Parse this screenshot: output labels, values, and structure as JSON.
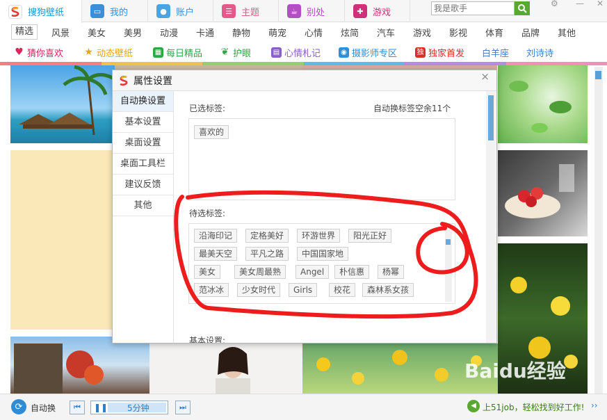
{
  "tabs": [
    {
      "label": "搜狗壁纸",
      "icon": "sogou-logo-icon",
      "color": "#1a9ad6"
    },
    {
      "label": "我的",
      "icon": "monitor-icon",
      "color": "#3a8fd8"
    },
    {
      "label": "账户",
      "icon": "user-icon",
      "color": "#4ba3e0"
    },
    {
      "label": "主题",
      "icon": "theme-icon",
      "color": "#e45a8a"
    },
    {
      "label": "别处",
      "icon": "elsewhere-icon",
      "color": "#b44ec4"
    },
    {
      "label": "游戏",
      "icon": "gamepad-icon",
      "color": "#d0307a"
    }
  ],
  "search": {
    "placeholder": "我是歌手"
  },
  "categories": [
    "精选",
    "风景",
    "美女",
    "美男",
    "动漫",
    "卡通",
    "静物",
    "萌宠",
    "心情",
    "炫简",
    "汽车",
    "游戏",
    "影视",
    "体育",
    "品牌",
    "其他"
  ],
  "features": [
    {
      "label": "猜你喜欢",
      "icon": "heart-icon",
      "color": "#e0245e"
    },
    {
      "label": "动态壁纸",
      "icon": "star-icon",
      "color": "#e8a317"
    },
    {
      "label": "每日精品",
      "icon": "calendar-icon",
      "color": "#2aa84a"
    },
    {
      "label": "护眼",
      "icon": "leaf-icon",
      "color": "#28a745"
    },
    {
      "label": "心情札记",
      "icon": "notebook-icon",
      "color": "#8a5fc7"
    },
    {
      "label": "摄影师专区",
      "icon": "camera-icon",
      "color": "#2d8fd5"
    },
    {
      "label": "独家首发",
      "icon": "exclusive-icon",
      "color": "#d9302c"
    },
    {
      "label": "白羊座",
      "icon": "",
      "color": "#4a7dcc"
    },
    {
      "label": "刘诗诗",
      "icon": "",
      "color": "#3d7fd0"
    }
  ],
  "dialog": {
    "title": "属性设置",
    "close": "×",
    "sidebar": [
      "自动换设置",
      "基本设置",
      "桌面设置",
      "桌面工具栏",
      "建议反馈",
      "其他"
    ],
    "selected_label": "已选标签:",
    "remaining": "自动换标签空余11个",
    "selected_tags": [
      "喜欢的"
    ],
    "candidate_label": "待选标签:",
    "candidate_tags": [
      [
        "沿海印记",
        "定格美好",
        "环游世界",
        "阳光正好"
      ],
      [
        "最美天空",
        "平凡之路",
        "中国国家地"
      ],
      [
        "美女",
        "美女周最熟",
        "Angel",
        "朴信惠",
        "杨幂"
      ],
      [
        "范冰冰",
        "少女时代",
        "Girls",
        "校花",
        "森林系女孩"
      ]
    ],
    "basic_label": "基本设置:"
  },
  "bottom": {
    "auto_label": "自动换",
    "interval": "5分钟",
    "ad": "上51job，轻松找到好工作!",
    "watermark": "Baidu经验"
  }
}
